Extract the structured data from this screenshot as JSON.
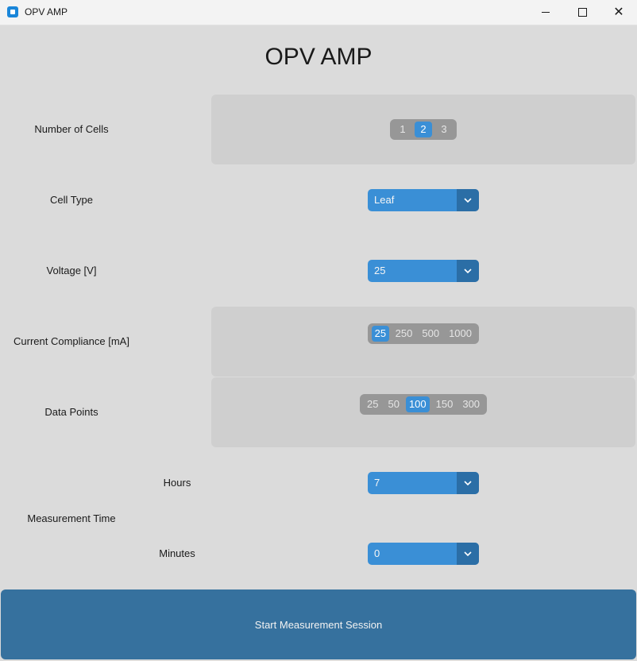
{
  "window": {
    "title": "OPV AMP",
    "minimize_glyph": "",
    "maximize_glyph": "",
    "close_glyph": "✕"
  },
  "app": {
    "heading": "OPV AMP"
  },
  "labels": {
    "cells": "Number of Cells",
    "cell_type": "Cell Type",
    "voltage": "Voltage [V]",
    "current": "Current Compliance [mA]",
    "data_points": "Data Points",
    "measurement_time": "Measurement Time",
    "hours": "Hours",
    "minutes": "Minutes"
  },
  "cells": {
    "options": [
      "1",
      "2",
      "3"
    ],
    "selected": "2"
  },
  "current": {
    "options": [
      "25",
      "250",
      "500",
      "1000"
    ],
    "selected": "25"
  },
  "data_points": {
    "options": [
      "25",
      "50",
      "100",
      "150",
      "300"
    ],
    "selected": "100"
  },
  "dropdowns": {
    "cell_type": "Leaf",
    "voltage": "25",
    "hours": "7",
    "minutes": "0"
  },
  "start_button": {
    "label": "Start Measurement Session"
  },
  "colors": {
    "accent": "#3a8fd6",
    "dropdown_arrow": "#2b6ea6",
    "start_button": "#36719e",
    "panel": "#cfcfcf",
    "segment_bg": "#979797"
  }
}
